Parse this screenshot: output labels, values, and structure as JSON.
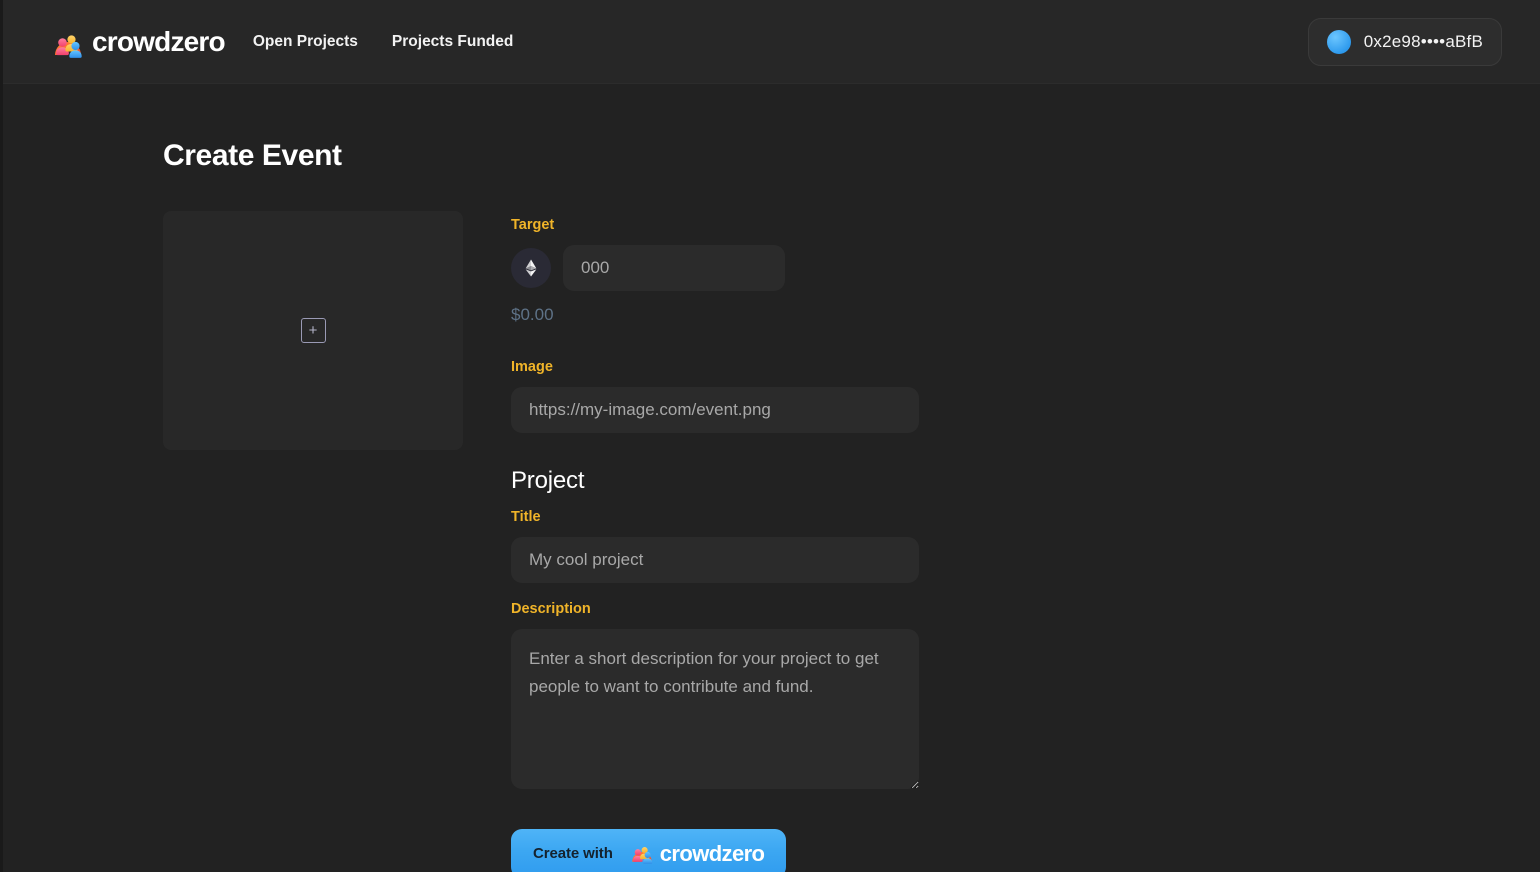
{
  "header": {
    "brand_name": "crowdzero",
    "logo_icon": "crowdzero-arch-people-logo",
    "nav": [
      {
        "label": "Open Projects",
        "name": "nav-open-projects"
      },
      {
        "label": "Projects Funded",
        "name": "nav-projects-funded"
      }
    ],
    "account": {
      "avatar_icon": "wallet-avatar-circle",
      "address": "0x2e98••••aBfB"
    }
  },
  "page": {
    "title": "Create Event"
  },
  "image_upload": {
    "add_icon": "plus-square-icon",
    "add_label": "+"
  },
  "form": {
    "target": {
      "label": "Target",
      "currency_icon": "ethereum-icon",
      "placeholder": "000",
      "value": "",
      "fiat_value": "$0.00"
    },
    "image": {
      "label": "Image",
      "placeholder": "https://my-image.com/event.png",
      "value": ""
    },
    "project_section_title": "Project",
    "title_field": {
      "label": "Title",
      "placeholder": "My cool project",
      "value": ""
    },
    "description_field": {
      "label": "Description",
      "placeholder": "Enter a short description for your project to get people to want to contribute and fund.",
      "value": ""
    },
    "submit": {
      "label": "Create with",
      "brand_name": "crowdzero",
      "logo_icon": "crowdzero-arch-people-logo"
    }
  },
  "colors": {
    "page_bg": "#222222",
    "header_bg": "#272727",
    "field_bg": "#2b2b2b",
    "label_accent": "#f0b429",
    "button_accent": "#3ca7f2",
    "fiat_text": "#5e7287"
  }
}
